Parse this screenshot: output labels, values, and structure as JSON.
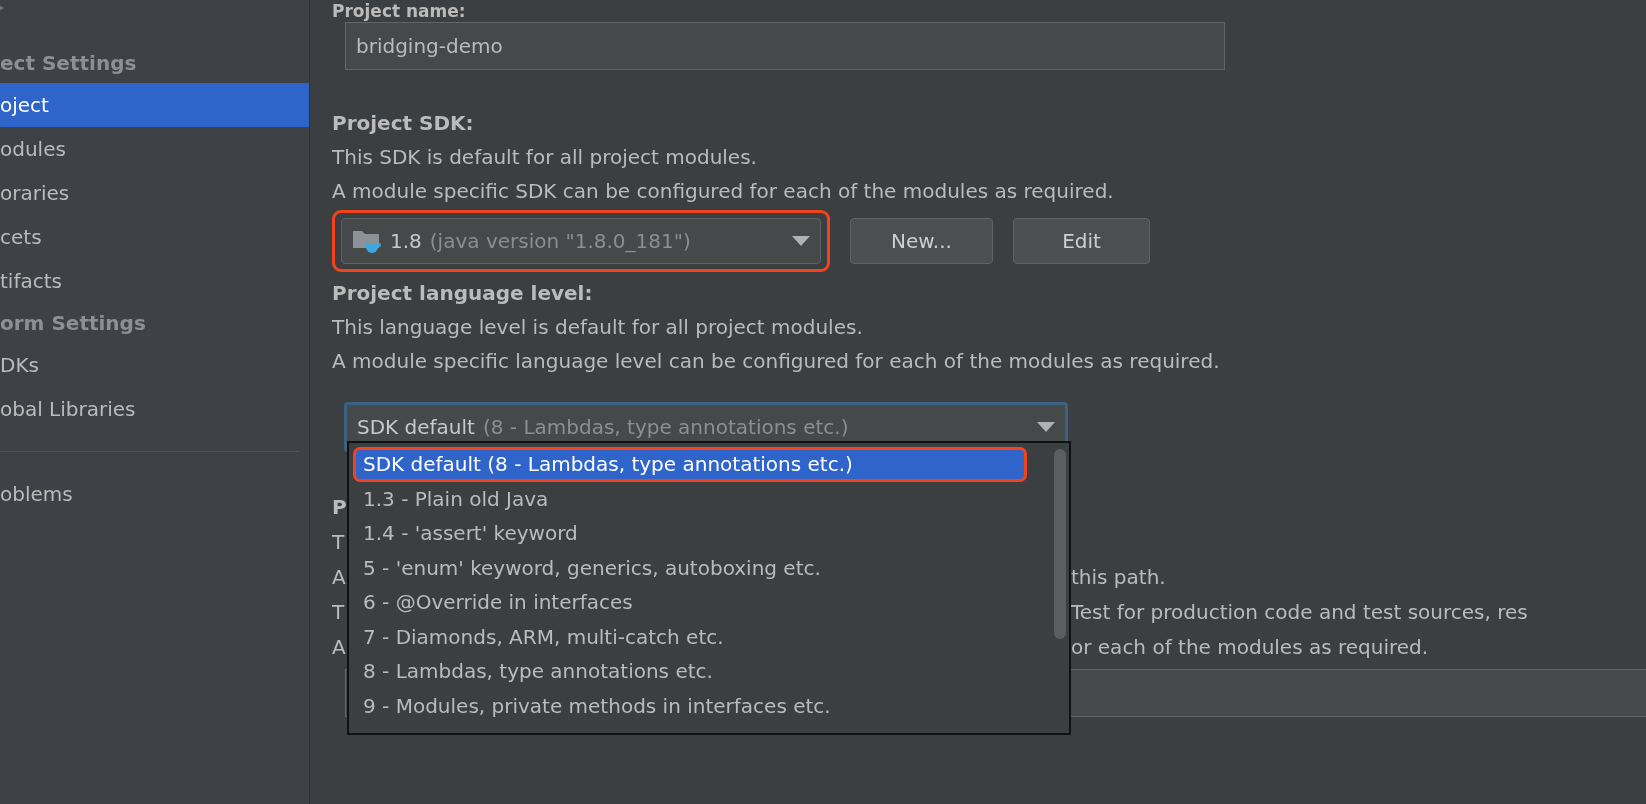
{
  "sidebar": {
    "items": [
      {
        "kind": "header",
        "label": "ect Settings"
      },
      {
        "kind": "item",
        "label": "oject",
        "selected": true
      },
      {
        "kind": "item",
        "label": "odules",
        "selected": false
      },
      {
        "kind": "item",
        "label": "oraries",
        "selected": false
      },
      {
        "kind": "item",
        "label": "cets",
        "selected": false
      },
      {
        "kind": "item",
        "label": "tifacts",
        "selected": false
      },
      {
        "kind": "header",
        "label": "orm Settings"
      },
      {
        "kind": "item",
        "label": "DKs",
        "selected": false
      },
      {
        "kind": "item",
        "label": "obal Libraries",
        "selected": false
      },
      {
        "kind": "divider"
      },
      {
        "kind": "item",
        "label": "oblems",
        "selected": false
      }
    ]
  },
  "project_name": {
    "label": "Project name:",
    "value": "bridging-demo"
  },
  "project_sdk": {
    "heading": "Project SDK:",
    "lines": [
      "This SDK is default for all project modules.",
      "A module specific SDK can be configured for each of the modules as required."
    ],
    "combo": {
      "value": "1.8",
      "detail": "(java version \"1.8.0_181\")",
      "annotated": true
    },
    "buttons": [
      "New...",
      "Edit"
    ]
  },
  "language_level": {
    "heading": "Project language level:",
    "lines": [
      "This language level is default for all project modules.",
      "A module specific language level can be configured for each of the modules as required."
    ],
    "combo": {
      "value": "SDK default",
      "detail": "(8 - Lambdas, type annotations etc.)",
      "focused": true
    },
    "popup": {
      "items": [
        {
          "label": "SDK default (8 - Lambdas, type annotations etc.)",
          "selected": true,
          "annotated": true
        },
        {
          "label": "1.3 - Plain old Java",
          "selected": false,
          "annotated": false
        },
        {
          "label": "1.4 - 'assert' keyword",
          "selected": false,
          "annotated": false
        },
        {
          "label": "5 - 'enum' keyword, generics, autoboxing etc.",
          "selected": false,
          "annotated": false
        },
        {
          "label": "6 - @Override in interfaces",
          "selected": false,
          "annotated": false
        },
        {
          "label": "7 - Diamonds, ARM, multi-catch etc.",
          "selected": false,
          "annotated": false
        },
        {
          "label": "8 - Lambdas, type annotations etc.",
          "selected": false,
          "annotated": false
        },
        {
          "label": "9 - Modules, private methods in interfaces etc.",
          "selected": false,
          "annotated": false
        }
      ]
    }
  },
  "covered_section": {
    "rows": [
      {
        "kind": "heading",
        "left": "P"
      },
      {
        "kind": "text",
        "left": "T"
      },
      {
        "kind": "text",
        "left": "A",
        "right": "this path."
      },
      {
        "kind": "text",
        "left": "T",
        "right": "Test for production code and test sources, res"
      },
      {
        "kind": "text",
        "left": "A",
        "right": "or each of the modules as required."
      }
    ]
  }
}
